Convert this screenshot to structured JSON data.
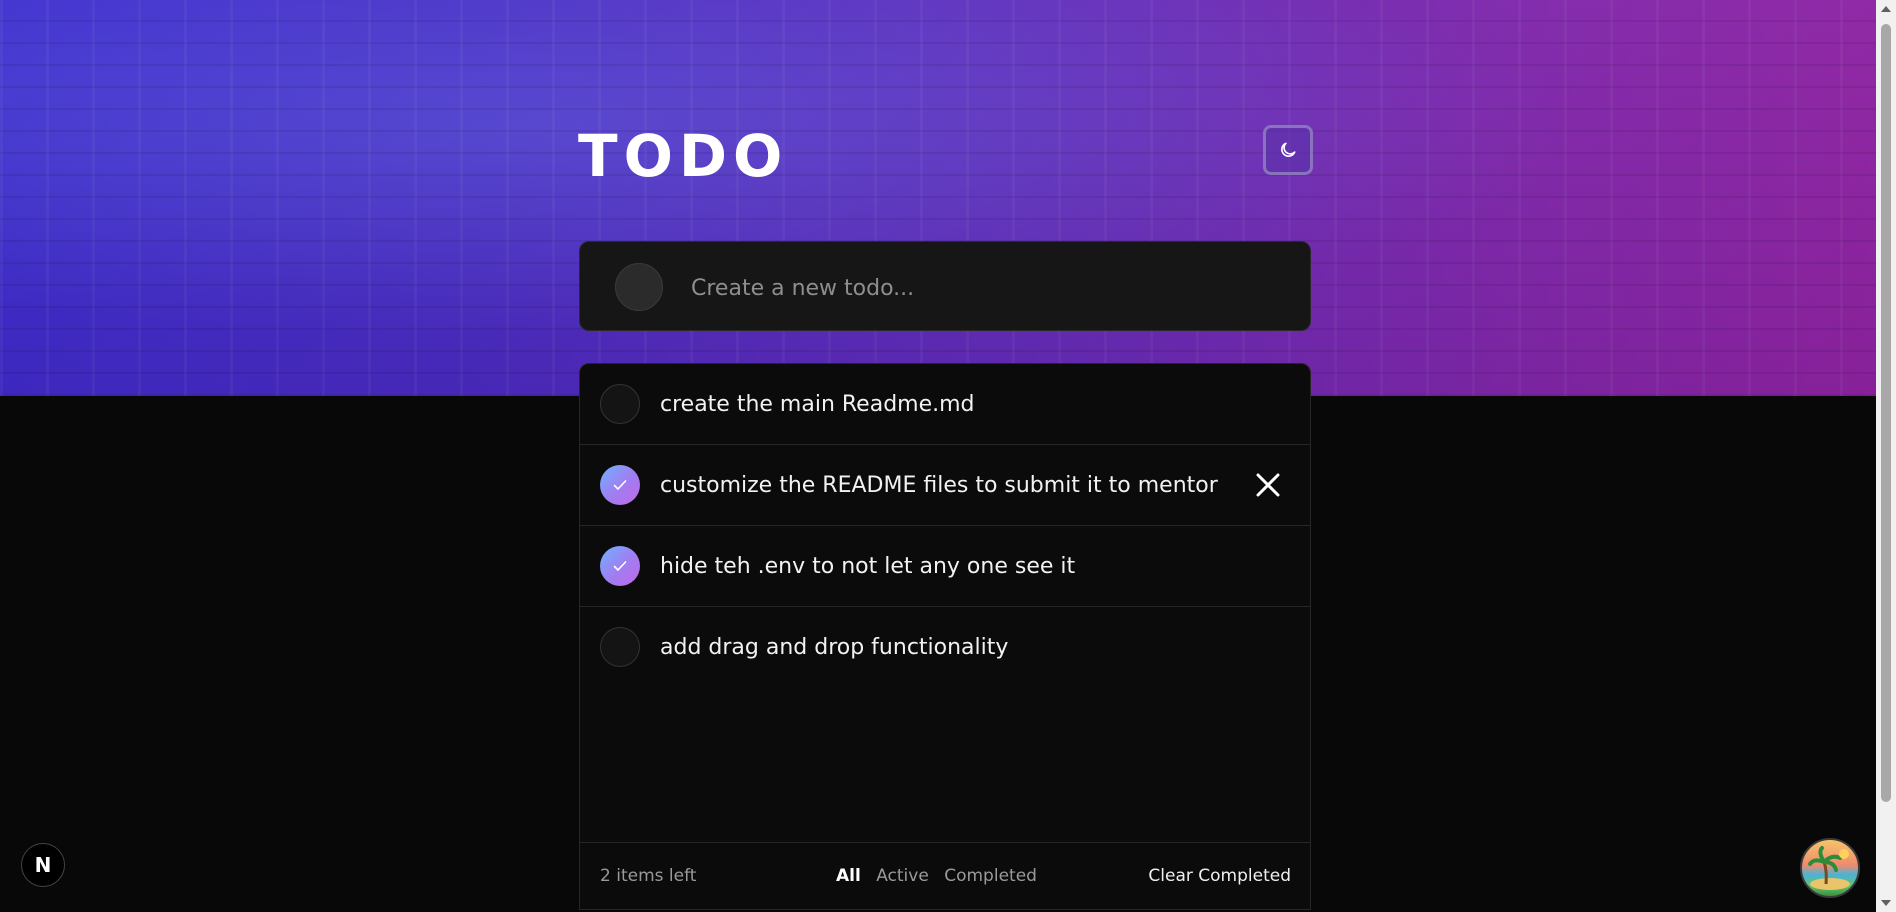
{
  "header": {
    "title": "TODO",
    "theme_icon": "moon-icon"
  },
  "new_todo": {
    "placeholder": "Create a new todo..."
  },
  "todos": [
    {
      "text": "create the main Readme.md",
      "completed": false
    },
    {
      "text": "customize the README files to submit it to mentor",
      "completed": true,
      "delete_icon": "close-icon"
    },
    {
      "text": "hide teh .env to not let any one see it",
      "completed": true
    },
    {
      "text": "add drag and drop functionality",
      "completed": false
    }
  ],
  "footer": {
    "items_left": "2 items left",
    "filters": [
      "All",
      "Active",
      "Completed"
    ],
    "active_filter": "All",
    "clear_label": "Clear Completed"
  },
  "corner": {
    "badge_letter": "N"
  },
  "colors": {
    "page_bg": "#080808",
    "card_bg": "#0b0b0b",
    "check_gradient_start": "#6fb3ff",
    "check_gradient_end": "#c06ae8"
  }
}
